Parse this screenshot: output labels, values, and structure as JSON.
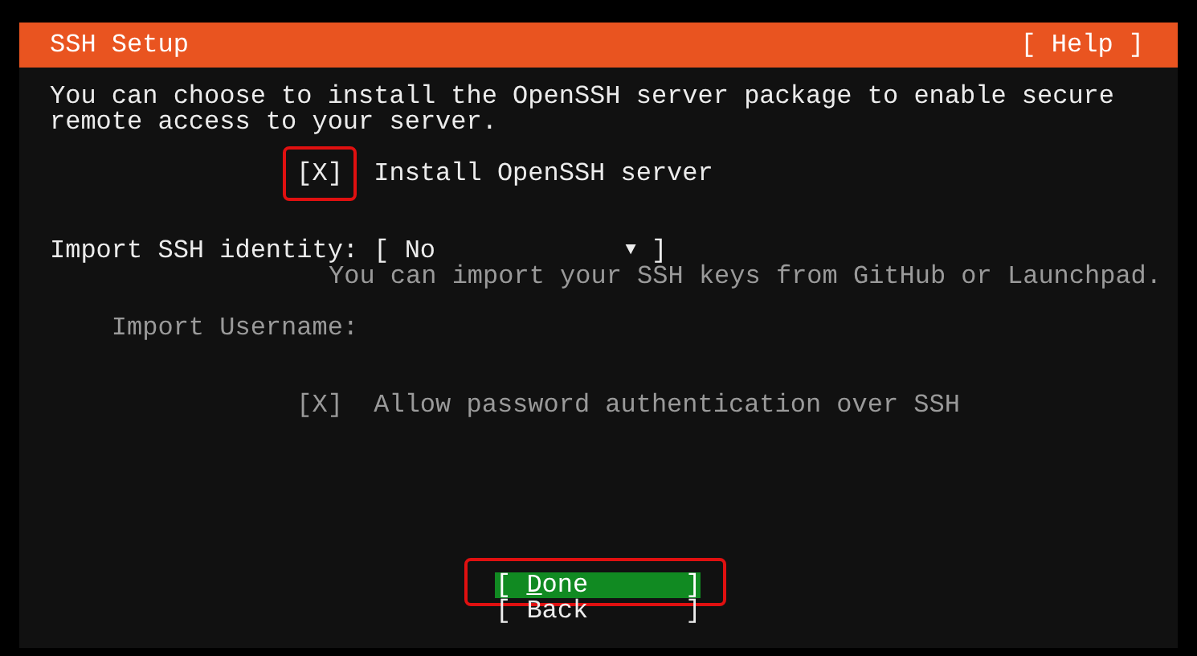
{
  "title_bar": {
    "title": "SSH Setup",
    "help": "[ Help ]"
  },
  "description": "You can choose to install the OpenSSH server package to enable secure remote access to your server.",
  "install_checkbox": {
    "bracket_left": "[",
    "mark": "X",
    "bracket_right": "]",
    "label": "Install OpenSSH server",
    "checked": true,
    "disabled": false,
    "highlighted": true
  },
  "import_identity": {
    "label": "Import SSH identity:",
    "bracket_left": "[",
    "value": "No",
    "caret": "▼",
    "bracket_right": "]",
    "hint": "You can import your SSH keys from GitHub or Launchpad."
  },
  "import_username": {
    "label": "Import Username:",
    "disabled": true
  },
  "password_checkbox": {
    "bracket_left": "[",
    "mark": "X",
    "bracket_right": "]",
    "label": "Allow password authentication over SSH",
    "checked": true,
    "disabled": true,
    "highlighted": false
  },
  "buttons": [
    {
      "bracket_left": "[",
      "access_key": "D",
      "label_rest": "one",
      "bracket_right": "]",
      "selected": true,
      "highlighted": true
    },
    {
      "bracket_left": "[",
      "label": "Back",
      "bracket_right": "]",
      "selected": false,
      "highlighted": false
    }
  ]
}
